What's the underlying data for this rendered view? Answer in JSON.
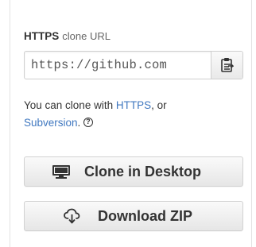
{
  "clone_panel": {
    "protocol_label": "HTTPS",
    "clone_url_label": "clone URL",
    "clone_url": "https://github.com",
    "help": {
      "prefix": "You can clone with ",
      "https_link": "HTTPS",
      "middle": ", or",
      "subversion_link": "Subversion",
      "suffix": "."
    },
    "clone_desktop_label": "Clone in Desktop",
    "download_zip_label": "Download ZIP",
    "icons": {
      "copy": "clipboard-icon",
      "help": "question-circle-icon",
      "desktop": "monitor-icon",
      "download": "cloud-download-icon"
    }
  }
}
